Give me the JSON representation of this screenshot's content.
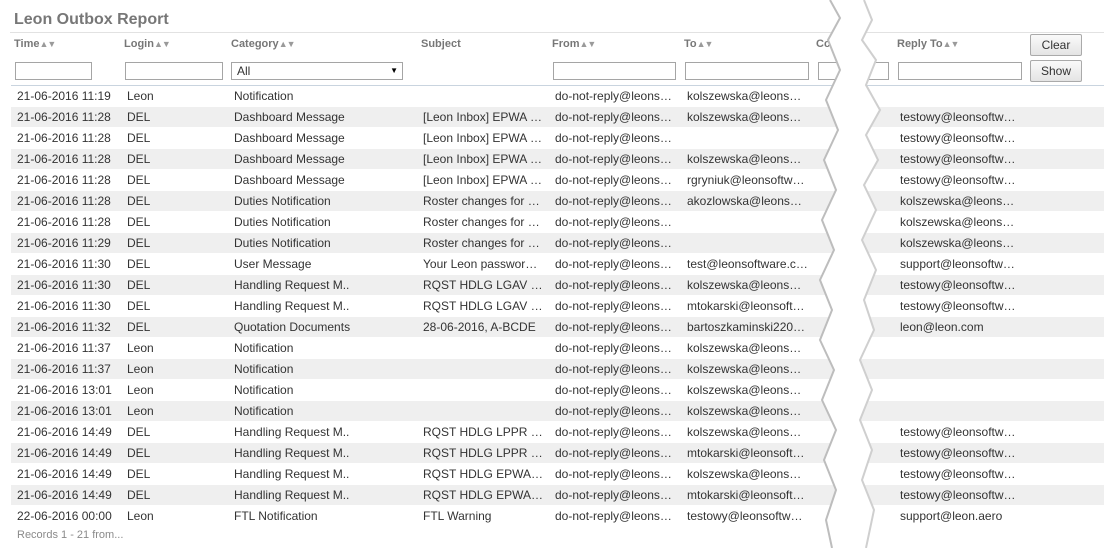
{
  "report": {
    "title": "Leon Outbox Report",
    "headers": {
      "time": "Time",
      "login": "Login",
      "category": "Category",
      "subject": "Subject",
      "from": "From",
      "to": "To",
      "cc": "Cc",
      "reply_to": "Reply To"
    },
    "sort_icon": "sort-arrows-icon",
    "category_filter_value": "All",
    "buttons": {
      "clear": "Clear",
      "show": "Show"
    },
    "rows": [
      {
        "time": "21-06-2016 11:19",
        "login": "Leon",
        "category": "Notification",
        "subject": "",
        "from": "do-not-reply@leons…",
        "to": "kolszewska@leons…",
        "reply_to": ""
      },
      {
        "time": "21-06-2016 11:28",
        "login": "DEL",
        "category": "Dashboard Message",
        "subject": "[Leon Inbox] EPWA …",
        "from": "do-not-reply@leons…",
        "to": "kolszewska@leons…",
        "reply_to": "testowy@leonsoftw…"
      },
      {
        "time": "21-06-2016 11:28",
        "login": "DEL",
        "category": "Dashboard Message",
        "subject": "[Leon Inbox] EPWA …",
        "from": "do-not-reply@leons…",
        "to": "",
        "reply_to": "testowy@leonsoftw…"
      },
      {
        "time": "21-06-2016 11:28",
        "login": "DEL",
        "category": "Dashboard Message",
        "subject": "[Leon Inbox] EPWA …",
        "from": "do-not-reply@leons…",
        "to": "kolszewska@leons…",
        "reply_to": "testowy@leonsoftw…"
      },
      {
        "time": "21-06-2016 11:28",
        "login": "DEL",
        "category": "Dashboard Message",
        "subject": "[Leon Inbox] EPWA …",
        "from": "do-not-reply@leons…",
        "to": "rgryniuk@leonsoftw…",
        "reply_to": "testowy@leonsoftw…"
      },
      {
        "time": "21-06-2016 11:28",
        "login": "DEL",
        "category": "Duties Notification",
        "subject": "Roster changes for …",
        "from": "do-not-reply@leons…",
        "to": "akozlowska@leons…",
        "reply_to": "kolszewska@leons…"
      },
      {
        "time": "21-06-2016 11:28",
        "login": "DEL",
        "category": "Duties Notification",
        "subject": "Roster changes for …",
        "from": "do-not-reply@leons…",
        "to": "",
        "reply_to": "kolszewska@leons…"
      },
      {
        "time": "21-06-2016 11:29",
        "login": "DEL",
        "category": "Duties Notification",
        "subject": "Roster changes for …",
        "from": "do-not-reply@leons…",
        "to": "",
        "reply_to": "kolszewska@leons…"
      },
      {
        "time": "21-06-2016 11:30",
        "login": "DEL",
        "category": "User Message",
        "subject": "Your Leon passwor…",
        "from": "do-not-reply@leons…",
        "to": "test@leonsoftware.c…",
        "reply_to": "support@leonsoftw…"
      },
      {
        "time": "21-06-2016 11:30",
        "login": "DEL",
        "category": "Handling Request M..",
        "subject": "RQST HDLG LGAV …",
        "from": "do-not-reply@leons…",
        "to": "kolszewska@leons…",
        "reply_to": "testowy@leonsoftw…"
      },
      {
        "time": "21-06-2016 11:30",
        "login": "DEL",
        "category": "Handling Request M..",
        "subject": "RQST HDLG LGAV …",
        "from": "do-not-reply@leons…",
        "to": "mtokarski@leonsoft…",
        "reply_to": "testowy@leonsoftw…"
      },
      {
        "time": "21-06-2016 11:32",
        "login": "DEL",
        "category": "Quotation Documents",
        "subject": "28-06-2016, A-BCDE",
        "from": "do-not-reply@leons…",
        "to": "bartoszkaminski220…",
        "reply_to": "leon@leon.com"
      },
      {
        "time": "21-06-2016 11:37",
        "login": "Leon",
        "category": "Notification",
        "subject": "",
        "from": "do-not-reply@leons…",
        "to": "kolszewska@leons…",
        "reply_to": ""
      },
      {
        "time": "21-06-2016 11:37",
        "login": "Leon",
        "category": "Notification",
        "subject": "",
        "from": "do-not-reply@leons…",
        "to": "kolszewska@leons…",
        "reply_to": ""
      },
      {
        "time": "21-06-2016 13:01",
        "login": "Leon",
        "category": "Notification",
        "subject": "",
        "from": "do-not-reply@leons…",
        "to": "kolszewska@leons…",
        "reply_to": ""
      },
      {
        "time": "21-06-2016 13:01",
        "login": "Leon",
        "category": "Notification",
        "subject": "",
        "from": "do-not-reply@leons…",
        "to": "kolszewska@leons…",
        "reply_to": ""
      },
      {
        "time": "21-06-2016 14:49",
        "login": "DEL",
        "category": "Handling Request M..",
        "subject": "RQST HDLG LPPR …",
        "from": "do-not-reply@leons…",
        "to": "kolszewska@leons…",
        "reply_to": "testowy@leonsoftw…"
      },
      {
        "time": "21-06-2016 14:49",
        "login": "DEL",
        "category": "Handling Request M..",
        "subject": "RQST HDLG LPPR …",
        "from": "do-not-reply@leons…",
        "to": "mtokarski@leonsoft…",
        "reply_to": "testowy@leonsoftw…"
      },
      {
        "time": "21-06-2016 14:49",
        "login": "DEL",
        "category": "Handling Request M..",
        "subject": "RQST HDLG EPWA…",
        "from": "do-not-reply@leons…",
        "to": "kolszewska@leons…",
        "reply_to": "testowy@leonsoftw…"
      },
      {
        "time": "21-06-2016 14:49",
        "login": "DEL",
        "category": "Handling Request M..",
        "subject": "RQST HDLG EPWA…",
        "from": "do-not-reply@leons…",
        "to": "mtokarski@leonsoft…",
        "reply_to": "testowy@leonsoftw…"
      },
      {
        "time": "22-06-2016 00:00",
        "login": "Leon",
        "category": "FTL Notification",
        "subject": "FTL Warning",
        "from": "do-not-reply@leons…",
        "to": "testowy@leonsoftw…",
        "reply_to": "support@leon.aero"
      }
    ],
    "footer": "Records 1 - 21 from..."
  }
}
